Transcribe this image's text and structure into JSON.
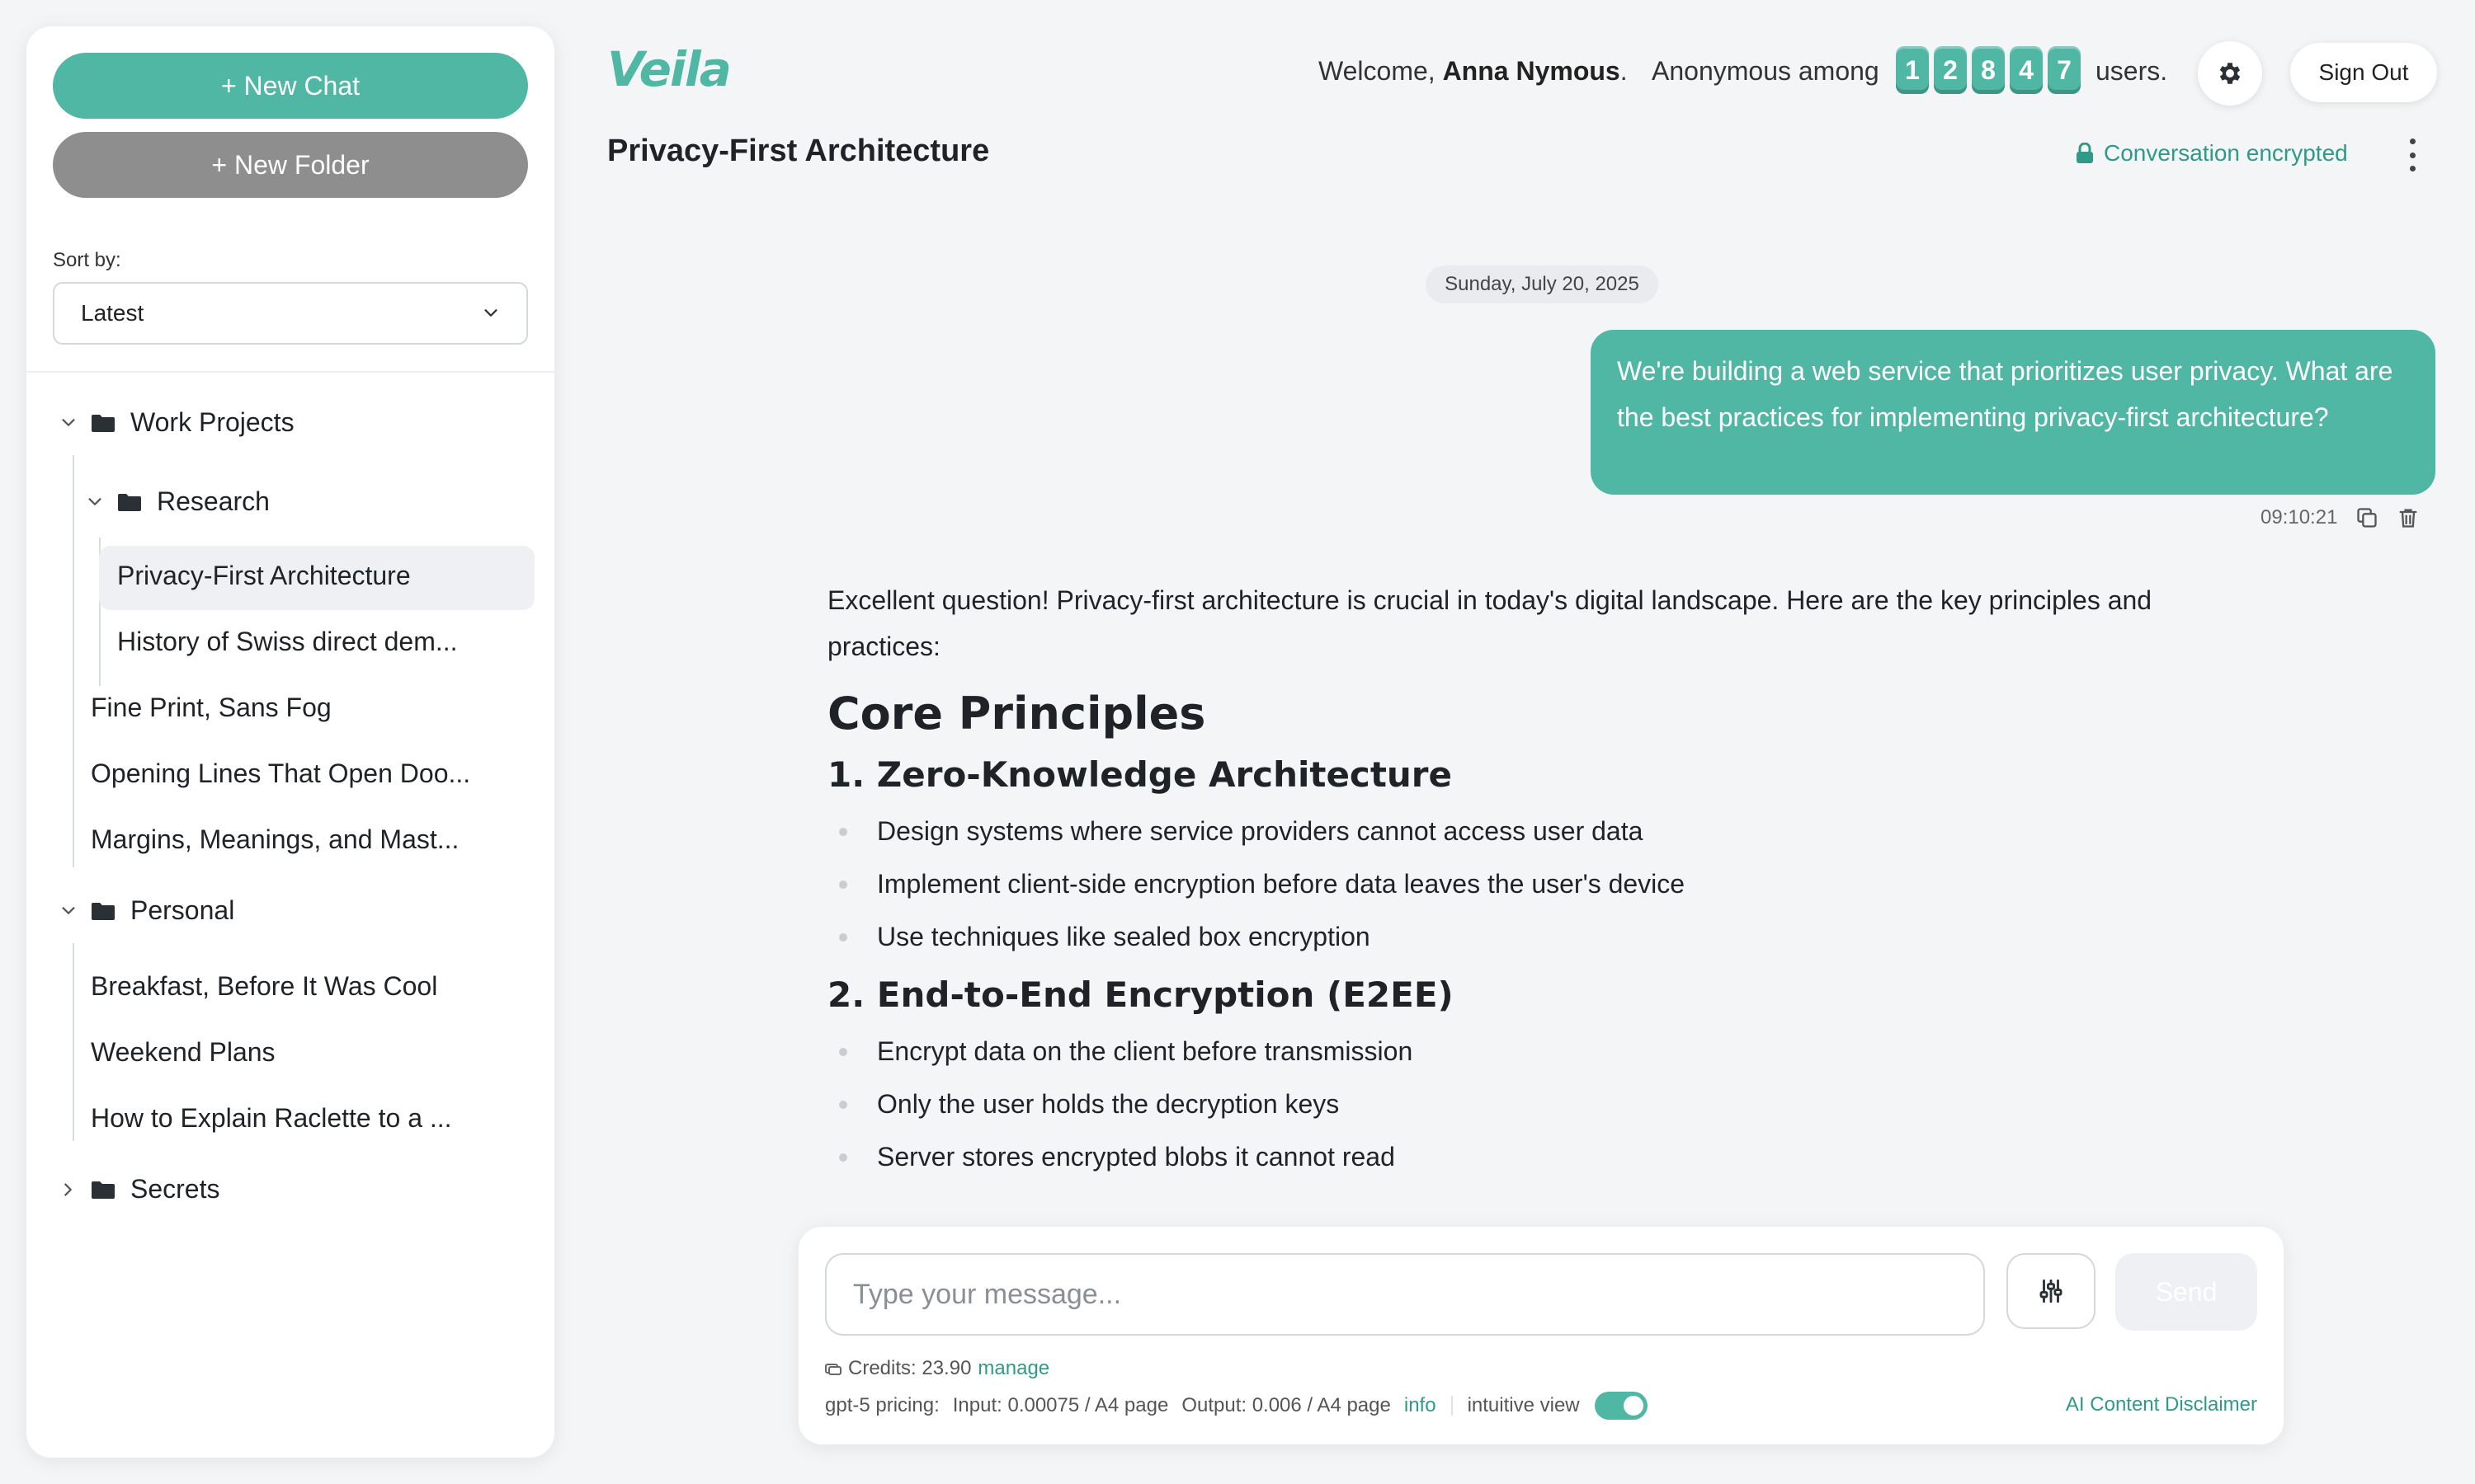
{
  "sidebar": {
    "new_chat": "+ New Chat",
    "new_folder": "+ New Folder",
    "sort_label": "Sort by:",
    "sort_value": "Latest",
    "folders": [
      {
        "name": "Work Projects",
        "expanded": true
      },
      {
        "name": "Research",
        "expanded": true
      },
      {
        "name": "Personal",
        "expanded": true
      },
      {
        "name": "Secrets",
        "expanded": false
      }
    ],
    "chats": {
      "research": [
        "Privacy-First Architecture",
        "History of Swiss direct dem..."
      ],
      "work": [
        "Fine Print, Sans Fog",
        "Opening Lines That Open Doo...",
        "Margins, Meanings, and Mast..."
      ],
      "personal": [
        "Breakfast, Before It Was Cool",
        "Weekend Plans",
        "How to Explain Raclette to a ..."
      ]
    }
  },
  "header": {
    "logo": "Veila",
    "welcome_prefix": "Welcome,",
    "user_name": "Anna Nymous",
    "welcome_suffix": ".",
    "anon_text": "Anonymous among",
    "user_count_digits": [
      "1",
      "2",
      "8",
      "4",
      "7"
    ],
    "users_suffix": "users.",
    "sign_out": "Sign Out",
    "conversation_title": "Privacy-First Architecture",
    "encrypted_label": "Conversation encrypted"
  },
  "conversation": {
    "date": "Sunday, July 20, 2025",
    "user_message": "We're building a web service that prioritizes user privacy. What are the best practices for implementing privacy-first architecture?",
    "user_time": "09:10:21",
    "assistant": {
      "intro": "Excellent question! Privacy-first architecture is crucial in today's digital landscape. Here are the key principles and practices:",
      "h2": "Core Principles",
      "sections": [
        {
          "title": "1. Zero-Knowledge Architecture",
          "items": [
            "Design systems where service providers cannot access user data",
            "Implement client-side encryption before data leaves the user's device",
            "Use techniques like sealed box encryption"
          ]
        },
        {
          "title": "2. End-to-End Encryption (E2EE)",
          "items": [
            "Encrypt data on the client before transmission",
            "Only the user holds the decryption keys",
            "Server stores encrypted blobs it cannot read"
          ]
        }
      ]
    }
  },
  "composer": {
    "placeholder": "Type your message...",
    "send": "Send",
    "credits_label": "Credits: 23.90",
    "manage": "manage",
    "pricing_model": "gpt-5 pricing:",
    "input_price": "Input: 0.00075 / A4 page",
    "output_price": "Output: 0.006 / A4 page",
    "info": "info",
    "intuitive_view": "intuitive view",
    "intuitive_view_on": true,
    "disclaimer": "AI Content Disclaimer"
  },
  "colors": {
    "accent": "#4fb7a4",
    "accent_text": "#2e9a87",
    "folder_button": "#8e8e8e",
    "background": "#f4f5f7"
  },
  "icons": [
    "folder-icon",
    "chevron-down-icon",
    "chevron-right-icon",
    "gear-icon",
    "lock-icon",
    "kebab-menu-icon",
    "copy-icon",
    "trash-icon",
    "sliders-icon",
    "credits-icon"
  ]
}
